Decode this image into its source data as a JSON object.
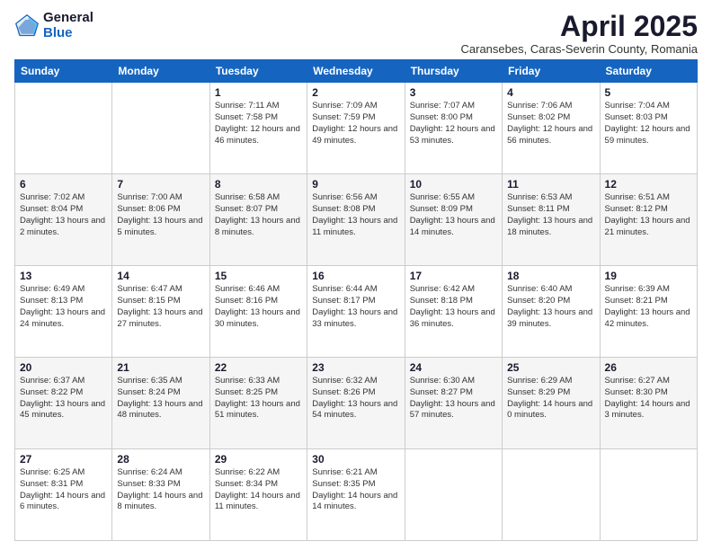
{
  "logo": {
    "general": "General",
    "blue": "Blue"
  },
  "header": {
    "month": "April 2025",
    "location": "Caransebes, Caras-Severin County, Romania"
  },
  "weekdays": [
    "Sunday",
    "Monday",
    "Tuesday",
    "Wednesday",
    "Thursday",
    "Friday",
    "Saturday"
  ],
  "weeks": [
    [
      {
        "day": "",
        "info": ""
      },
      {
        "day": "",
        "info": ""
      },
      {
        "day": "1",
        "info": "Sunrise: 7:11 AM\nSunset: 7:58 PM\nDaylight: 12 hours and 46 minutes."
      },
      {
        "day": "2",
        "info": "Sunrise: 7:09 AM\nSunset: 7:59 PM\nDaylight: 12 hours and 49 minutes."
      },
      {
        "day": "3",
        "info": "Sunrise: 7:07 AM\nSunset: 8:00 PM\nDaylight: 12 hours and 53 minutes."
      },
      {
        "day": "4",
        "info": "Sunrise: 7:06 AM\nSunset: 8:02 PM\nDaylight: 12 hours and 56 minutes."
      },
      {
        "day": "5",
        "info": "Sunrise: 7:04 AM\nSunset: 8:03 PM\nDaylight: 12 hours and 59 minutes."
      }
    ],
    [
      {
        "day": "6",
        "info": "Sunrise: 7:02 AM\nSunset: 8:04 PM\nDaylight: 13 hours and 2 minutes."
      },
      {
        "day": "7",
        "info": "Sunrise: 7:00 AM\nSunset: 8:06 PM\nDaylight: 13 hours and 5 minutes."
      },
      {
        "day": "8",
        "info": "Sunrise: 6:58 AM\nSunset: 8:07 PM\nDaylight: 13 hours and 8 minutes."
      },
      {
        "day": "9",
        "info": "Sunrise: 6:56 AM\nSunset: 8:08 PM\nDaylight: 13 hours and 11 minutes."
      },
      {
        "day": "10",
        "info": "Sunrise: 6:55 AM\nSunset: 8:09 PM\nDaylight: 13 hours and 14 minutes."
      },
      {
        "day": "11",
        "info": "Sunrise: 6:53 AM\nSunset: 8:11 PM\nDaylight: 13 hours and 18 minutes."
      },
      {
        "day": "12",
        "info": "Sunrise: 6:51 AM\nSunset: 8:12 PM\nDaylight: 13 hours and 21 minutes."
      }
    ],
    [
      {
        "day": "13",
        "info": "Sunrise: 6:49 AM\nSunset: 8:13 PM\nDaylight: 13 hours and 24 minutes."
      },
      {
        "day": "14",
        "info": "Sunrise: 6:47 AM\nSunset: 8:15 PM\nDaylight: 13 hours and 27 minutes."
      },
      {
        "day": "15",
        "info": "Sunrise: 6:46 AM\nSunset: 8:16 PM\nDaylight: 13 hours and 30 minutes."
      },
      {
        "day": "16",
        "info": "Sunrise: 6:44 AM\nSunset: 8:17 PM\nDaylight: 13 hours and 33 minutes."
      },
      {
        "day": "17",
        "info": "Sunrise: 6:42 AM\nSunset: 8:18 PM\nDaylight: 13 hours and 36 minutes."
      },
      {
        "day": "18",
        "info": "Sunrise: 6:40 AM\nSunset: 8:20 PM\nDaylight: 13 hours and 39 minutes."
      },
      {
        "day": "19",
        "info": "Sunrise: 6:39 AM\nSunset: 8:21 PM\nDaylight: 13 hours and 42 minutes."
      }
    ],
    [
      {
        "day": "20",
        "info": "Sunrise: 6:37 AM\nSunset: 8:22 PM\nDaylight: 13 hours and 45 minutes."
      },
      {
        "day": "21",
        "info": "Sunrise: 6:35 AM\nSunset: 8:24 PM\nDaylight: 13 hours and 48 minutes."
      },
      {
        "day": "22",
        "info": "Sunrise: 6:33 AM\nSunset: 8:25 PM\nDaylight: 13 hours and 51 minutes."
      },
      {
        "day": "23",
        "info": "Sunrise: 6:32 AM\nSunset: 8:26 PM\nDaylight: 13 hours and 54 minutes."
      },
      {
        "day": "24",
        "info": "Sunrise: 6:30 AM\nSunset: 8:27 PM\nDaylight: 13 hours and 57 minutes."
      },
      {
        "day": "25",
        "info": "Sunrise: 6:29 AM\nSunset: 8:29 PM\nDaylight: 14 hours and 0 minutes."
      },
      {
        "day": "26",
        "info": "Sunrise: 6:27 AM\nSunset: 8:30 PM\nDaylight: 14 hours and 3 minutes."
      }
    ],
    [
      {
        "day": "27",
        "info": "Sunrise: 6:25 AM\nSunset: 8:31 PM\nDaylight: 14 hours and 6 minutes."
      },
      {
        "day": "28",
        "info": "Sunrise: 6:24 AM\nSunset: 8:33 PM\nDaylight: 14 hours and 8 minutes."
      },
      {
        "day": "29",
        "info": "Sunrise: 6:22 AM\nSunset: 8:34 PM\nDaylight: 14 hours and 11 minutes."
      },
      {
        "day": "30",
        "info": "Sunrise: 6:21 AM\nSunset: 8:35 PM\nDaylight: 14 hours and 14 minutes."
      },
      {
        "day": "",
        "info": ""
      },
      {
        "day": "",
        "info": ""
      },
      {
        "day": "",
        "info": ""
      }
    ]
  ]
}
